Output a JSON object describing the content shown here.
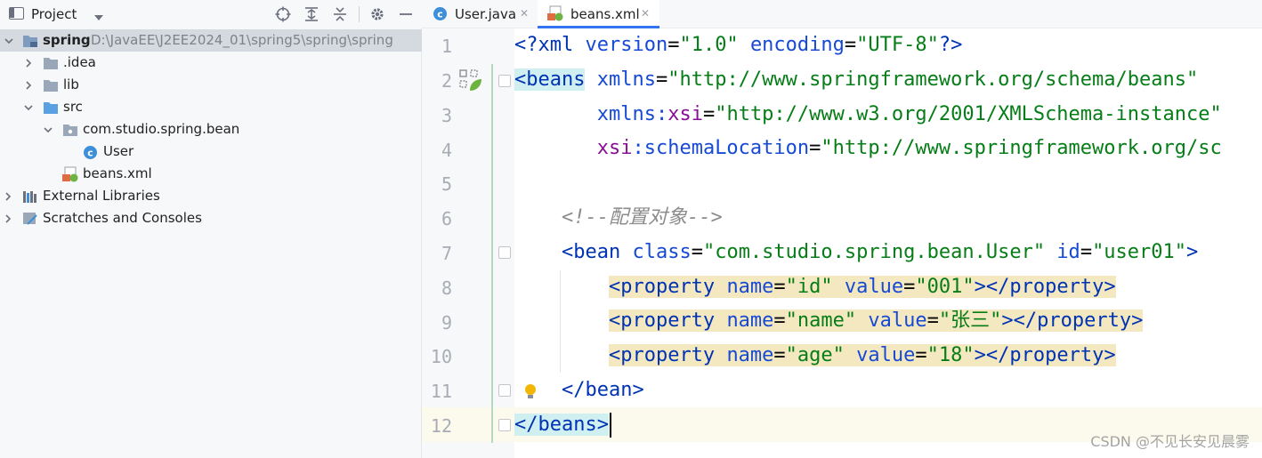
{
  "project_panel": {
    "title": "Project",
    "tree": [
      {
        "label": "spring",
        "path": "D:\\JavaEE\\J2EE2024_01\\spring5\\spring\\spring",
        "type": "module",
        "expanded": true,
        "depth": 0,
        "selected": true
      },
      {
        "label": ".idea",
        "type": "folder",
        "expanded": false,
        "depth": 1
      },
      {
        "label": "lib",
        "type": "folder",
        "expanded": false,
        "depth": 1
      },
      {
        "label": "src",
        "type": "source-folder",
        "expanded": true,
        "depth": 1
      },
      {
        "label": "com.studio.spring.bean",
        "type": "package",
        "expanded": true,
        "depth": 2
      },
      {
        "label": "User",
        "type": "class",
        "depth": 3
      },
      {
        "label": "beans.xml",
        "type": "xml-file",
        "depth": 2
      },
      {
        "label": "External Libraries",
        "type": "libraries",
        "expanded": false,
        "depth": 0
      },
      {
        "label": "Scratches and Consoles",
        "type": "scratches",
        "expanded": false,
        "depth": 0
      }
    ]
  },
  "editor": {
    "tabs": [
      {
        "label": "User.java",
        "icon": "class-icon",
        "active": false
      },
      {
        "label": "beans.xml",
        "icon": "spring-xml-icon",
        "active": true
      }
    ],
    "lines": [
      {
        "num": "1",
        "text": "<?xml version=\"1.0\" encoding=\"UTF-8\"?>"
      },
      {
        "num": "2",
        "text": "<beans xmlns=\"http://www.springframework.org/schema/beans\""
      },
      {
        "num": "3",
        "text": "       xmlns:xsi=\"http://www.w3.org/2001/XMLSchema-instance\""
      },
      {
        "num": "4",
        "text": "       xsi:schemaLocation=\"http://www.springframework.org/sc"
      },
      {
        "num": "5",
        "text": ""
      },
      {
        "num": "6",
        "text": "    <!--配置对象-->"
      },
      {
        "num": "7",
        "text": "    <bean class=\"com.studio.spring.bean.User\" id=\"user01\">"
      },
      {
        "num": "8",
        "text": "        <property name=\"id\" value=\"001\"></property>"
      },
      {
        "num": "9",
        "text": "        <property name=\"name\" value=\"张三\"></property>"
      },
      {
        "num": "10",
        "text": "        <property name=\"age\" value=\"18\"></property>"
      },
      {
        "num": "11",
        "text": "    </bean>"
      },
      {
        "num": "12",
        "text": "</beans>"
      }
    ]
  },
  "watermark": "CSDN @不见长安见晨雾",
  "colors": {
    "accent": "#3574f0",
    "tag": "#0033b3",
    "string": "#067d17",
    "namespace": "#871094",
    "comment": "#8c8c8c"
  }
}
